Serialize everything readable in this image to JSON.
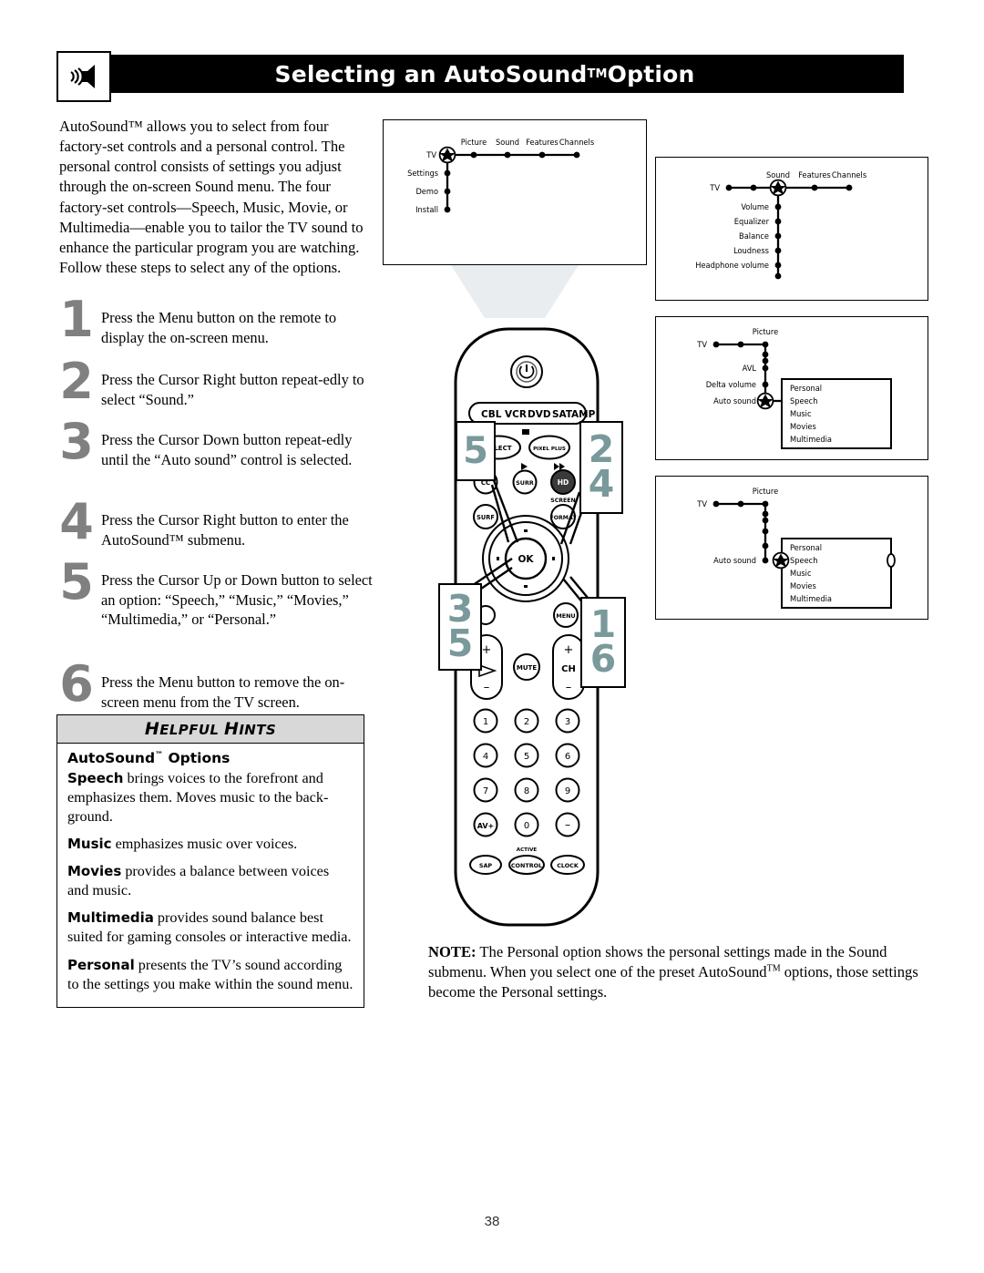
{
  "header": {
    "title_pre": "Selecting an AutoSound",
    "title_tm": "TM",
    "title_post": " Option",
    "icon": "speaker-icon"
  },
  "intro": {
    "text": "AutoSound™ allows you to select from four factory-set controls and a personal control. The personal control consists of settings you adjust through the on-screen Sound menu. The four factory-set controls—Speech, Music, Movie, or Multimedia—enable you to tailor the TV sound to enhance the particular program you are watching. Follow these steps to select any of the options."
  },
  "steps": [
    {
      "num": "1",
      "text": "Press the Menu button on the remote to display the on-screen menu."
    },
    {
      "num": "2",
      "text": "Press the Cursor Right button repeat-edly to select “Sound.”"
    },
    {
      "num": "3",
      "text": "Press the Cursor Down button repeat-edly until the “Auto sound” control is selected."
    },
    {
      "num": "4",
      "text": "Press the Cursor Right button to enter the AutoSound™ submenu."
    },
    {
      "num": "5",
      "text": "Press the Cursor Up or Down button to select an option: “Speech,” “Music,” “Movies,” “Multimedia,” or “Personal.”"
    },
    {
      "num": "6",
      "text": "Press the Menu button to remove the on-screen menu from the TV screen."
    }
  ],
  "hints": {
    "heading_first": "H",
    "heading_rest1": "ELPFUL ",
    "heading_h2": "H",
    "heading_rest2": "INTS",
    "options_title": "AutoSound",
    "options_title_tm": "™",
    "options_title_post": " Options",
    "items": [
      {
        "term": "Speech",
        "text": " brings voices to the forefront and emphasizes them. Moves music to the back-ground."
      },
      {
        "term": "Music",
        "text": " emphasizes music over voices."
      },
      {
        "term": "Movies",
        "text": " provides a balance between voices and music."
      },
      {
        "term": "Multimedia",
        "text": " provides sound balance best suited for gaming consoles or interactive media."
      },
      {
        "term": "Personal",
        "text": " presents the TV’s sound according to the settings you make within the sound menu."
      }
    ]
  },
  "diagrams": {
    "d1": {
      "root": "TV",
      "horizontal": [
        "Picture",
        "Sound",
        "Features",
        "Channels"
      ],
      "vertical": [
        "Settings",
        "Demo",
        "Install"
      ],
      "selected": "TV"
    },
    "d2": {
      "root": "TV",
      "horizontal": [
        "Sound",
        "Features",
        "Channels"
      ],
      "vertical": [
        "Volume",
        "Equalizer",
        "Balance",
        "Loudness",
        "Headphone volume"
      ],
      "selected": "Sound"
    },
    "d3": {
      "root": "TV",
      "horizontal": [
        "Picture"
      ],
      "vertical": [
        "AVL",
        "Delta volume",
        "Auto sound"
      ],
      "submenu": [
        "Personal",
        "Speech",
        "Music",
        "Movies",
        "Multimedia"
      ],
      "selected": "Auto sound"
    },
    "d4": {
      "root": "TV",
      "horizontal": [
        "Picture"
      ],
      "vertical": [
        "Auto sound"
      ],
      "submenu": [
        "Personal",
        "Speech",
        "Music",
        "Movies",
        "Multimedia"
      ],
      "selected": "Speech"
    }
  },
  "remote": {
    "power": "power-icon",
    "device_keys": [
      "CBL",
      "VCR",
      "DVD",
      "SAT",
      "AMP"
    ],
    "row_select": [
      "SELECT",
      "PIXEL PLUS"
    ],
    "row_media": [
      "CC",
      "SURR",
      "HD"
    ],
    "row_surf": [
      "SURF",
      "FORMAT"
    ],
    "format_label": "SCREEN",
    "ok": "OK",
    "menu": "MENU",
    "mute": "MUTE",
    "ch": "CH",
    "plus": "+",
    "minus": "–",
    "keypad": [
      "1",
      "2",
      "3",
      "4",
      "5",
      "6",
      "7",
      "8",
      "9",
      "AV+",
      "0",
      "–"
    ],
    "bottom_keys": [
      "SAP",
      "CONTROL",
      "CLOCK"
    ],
    "active_label": "ACTIVE"
  },
  "callouts": {
    "c5": "5",
    "c24_top": "2",
    "c24_bottom": "4",
    "c35_top": "3",
    "c35_bottom": "5",
    "c16_top": "1",
    "c16_bottom": "6"
  },
  "note": {
    "label": "NOTE:",
    "text_a": " The Personal option shows the personal settings made in the Sound submenu. When you select one of the preset AutoSound",
    "tm": "TM",
    "text_b": " options, those settings become the Personal settings."
  },
  "page_number": "38",
  "colors": {
    "header_bg": "#000000",
    "step_number": "#808080",
    "callout_number": "#79999b",
    "hints_header_bg": "#d8d8d8"
  }
}
